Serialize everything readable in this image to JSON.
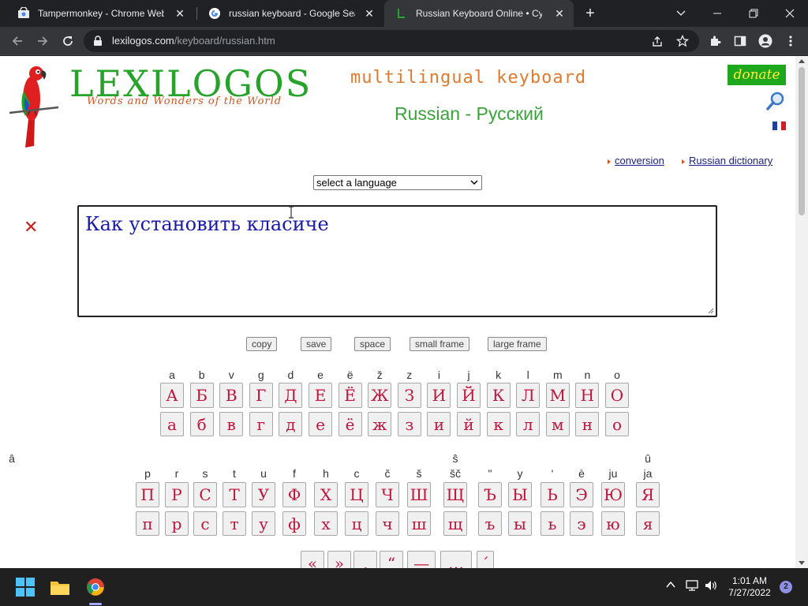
{
  "browser": {
    "tabs": [
      {
        "title": "Tampermonkey - Chrome Web Store"
      },
      {
        "title": "russian keyboard - Google Search"
      },
      {
        "title": "Russian Keyboard Online • Cyrillic"
      }
    ],
    "url_domain": "lexilogos.com",
    "url_path": "/keyboard/russian.htm"
  },
  "site": {
    "logo_text": "LEXILOGOS",
    "tagline": "Words and Wonders of the World",
    "heading": "multilingual keyboard",
    "language_title": "Russian - Русский",
    "donate_label": "donate"
  },
  "links": {
    "conversion": "conversion",
    "dictionary": "Russian dictionary"
  },
  "language_select": {
    "selected": "select a language"
  },
  "editor": {
    "text": "Как установить класиче"
  },
  "controls": {
    "copy": "copy",
    "save": "save",
    "space": "space",
    "small_frame": "small frame",
    "large_frame": "large frame"
  },
  "keyboard": {
    "row1_translit": [
      "a",
      "b",
      "v",
      "g",
      "d",
      "e",
      "ë",
      "ž",
      "z",
      "i",
      "j",
      "k",
      "l",
      "m",
      "n",
      "o"
    ],
    "row1_upper": [
      "А",
      "Б",
      "В",
      "Г",
      "Д",
      "Е",
      "Ё",
      "Ж",
      "З",
      "И",
      "Й",
      "К",
      "Л",
      "М",
      "Н",
      "О"
    ],
    "row1_lower": [
      "а",
      "б",
      "в",
      "г",
      "д",
      "е",
      "ё",
      "ж",
      "з",
      "и",
      "й",
      "к",
      "л",
      "м",
      "н",
      "о"
    ],
    "row2_translit_top": [
      "",
      "",
      "",
      "",
      "",
      "",
      "",
      "",
      "",
      "",
      "ŝ",
      "",
      "",
      "",
      "",
      "",
      "û",
      "â"
    ],
    "row2_translit": [
      "p",
      "r",
      "s",
      "t",
      "u",
      "f",
      "h",
      "c",
      "č",
      "š",
      "šč",
      "\"",
      "y",
      "'",
      "è",
      "ju",
      "ja"
    ],
    "row2_upper": [
      "П",
      "Р",
      "С",
      "Т",
      "У",
      "Ф",
      "Х",
      "Ц",
      "Ч",
      "Ш",
      "Щ",
      "Ъ",
      "Ы",
      "Ь",
      "Э",
      "Ю",
      "Я"
    ],
    "row2_lower": [
      "п",
      "р",
      "с",
      "т",
      "у",
      "ф",
      "х",
      "ц",
      "ч",
      "ш",
      "щ",
      "ъ",
      "ы",
      "ь",
      "э",
      "ю",
      "я"
    ],
    "row3_partial": [
      "«",
      "»",
      ",",
      "“",
      "—",
      "…",
      "´"
    ]
  },
  "taskbar": {
    "time": "1:01 AM",
    "date": "7/27/2022",
    "notifications": "2"
  },
  "colors": {
    "brand_green": "#27a32a",
    "key_text": "#c0143c",
    "editor_text": "#1a1aa8"
  }
}
